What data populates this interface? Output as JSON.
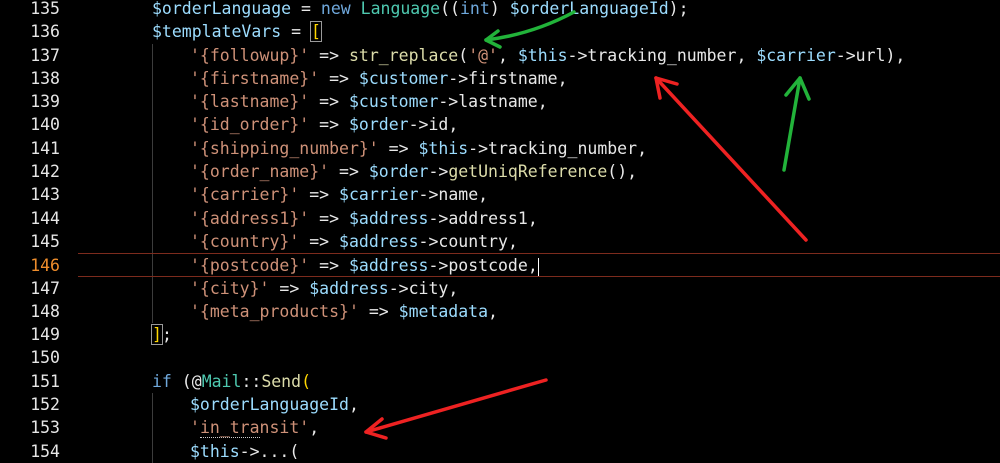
{
  "editor": {
    "lines": [
      {
        "num": "135",
        "tokens": [
          [
            "var",
            "$orderLanguage"
          ],
          [
            "op",
            " = "
          ],
          [
            "kw",
            "new"
          ],
          [
            "op",
            " "
          ],
          [
            "cls",
            "Language"
          ],
          [
            "op",
            "(("
          ],
          [
            "kw",
            "int"
          ],
          [
            "op",
            ") "
          ],
          [
            "var",
            "$orderLanguageId"
          ],
          [
            "op",
            ");"
          ]
        ]
      },
      {
        "num": "136",
        "tokens": [
          [
            "var",
            "$templateVars"
          ],
          [
            "op",
            " = "
          ],
          [
            "brkbox",
            "["
          ]
        ]
      },
      {
        "num": "137",
        "tokens": [
          [
            "str",
            "'{followup}'"
          ],
          [
            "op",
            " => "
          ],
          [
            "fn",
            "str_replace"
          ],
          [
            "op",
            "("
          ],
          [
            "str",
            "'@'"
          ],
          [
            "op",
            ", "
          ],
          [
            "var",
            "$this"
          ],
          [
            "op",
            "->"
          ],
          [
            "prop",
            "tracking_number"
          ],
          [
            "op",
            ", "
          ],
          [
            "var",
            "$carrier"
          ],
          [
            "op",
            "->"
          ],
          [
            "prop",
            "url"
          ],
          [
            "op",
            "),"
          ]
        ]
      },
      {
        "num": "138",
        "tokens": [
          [
            "str",
            "'{firstname}'"
          ],
          [
            "op",
            " => "
          ],
          [
            "var",
            "$customer"
          ],
          [
            "op",
            "->"
          ],
          [
            "prop",
            "firstname"
          ],
          [
            "op",
            ","
          ]
        ]
      },
      {
        "num": "139",
        "tokens": [
          [
            "str",
            "'{lastname}'"
          ],
          [
            "op",
            " => "
          ],
          [
            "var",
            "$customer"
          ],
          [
            "op",
            "->"
          ],
          [
            "prop",
            "lastname"
          ],
          [
            "op",
            ","
          ]
        ]
      },
      {
        "num": "140",
        "tokens": [
          [
            "str",
            "'{id_order}'"
          ],
          [
            "op",
            " => "
          ],
          [
            "var",
            "$order"
          ],
          [
            "op",
            "->"
          ],
          [
            "prop",
            "id"
          ],
          [
            "op",
            ","
          ]
        ]
      },
      {
        "num": "141",
        "tokens": [
          [
            "str",
            "'{shipping_number}'"
          ],
          [
            "op",
            " => "
          ],
          [
            "var",
            "$this"
          ],
          [
            "op",
            "->"
          ],
          [
            "prop",
            "tracking_number"
          ],
          [
            "op",
            ","
          ]
        ]
      },
      {
        "num": "142",
        "tokens": [
          [
            "str",
            "'{order_name}'"
          ],
          [
            "op",
            " => "
          ],
          [
            "var",
            "$order"
          ],
          [
            "op",
            "->"
          ],
          [
            "fn",
            "getUniqReference"
          ],
          [
            "op",
            "(),"
          ]
        ]
      },
      {
        "num": "143",
        "tokens": [
          [
            "str",
            "'{carrier}'"
          ],
          [
            "op",
            " => "
          ],
          [
            "var",
            "$carrier"
          ],
          [
            "op",
            "->"
          ],
          [
            "prop",
            "name"
          ],
          [
            "op",
            ","
          ]
        ]
      },
      {
        "num": "144",
        "tokens": [
          [
            "str",
            "'{address1}'"
          ],
          [
            "op",
            " => "
          ],
          [
            "var",
            "$address"
          ],
          [
            "op",
            "->"
          ],
          [
            "prop",
            "address1"
          ],
          [
            "op",
            ","
          ]
        ]
      },
      {
        "num": "145",
        "tokens": [
          [
            "str",
            "'{country}'"
          ],
          [
            "op",
            " => "
          ],
          [
            "var",
            "$address"
          ],
          [
            "op",
            "->"
          ],
          [
            "prop",
            "country"
          ],
          [
            "op",
            ","
          ]
        ]
      },
      {
        "num": "146",
        "tokens": [
          [
            "str",
            "'{postcode}'"
          ],
          [
            "op",
            " => "
          ],
          [
            "var",
            "$address"
          ],
          [
            "op",
            "->"
          ],
          [
            "prop",
            "postcode"
          ],
          [
            "op",
            ","
          ],
          [
            "cursor",
            ""
          ]
        ]
      },
      {
        "num": "147",
        "tokens": [
          [
            "str",
            "'{city}'"
          ],
          [
            "op",
            " => "
          ],
          [
            "var",
            "$address"
          ],
          [
            "op",
            "->"
          ],
          [
            "prop",
            "city"
          ],
          [
            "op",
            ","
          ]
        ]
      },
      {
        "num": "148",
        "tokens": [
          [
            "str",
            "'{meta_products}'"
          ],
          [
            "op",
            " => "
          ],
          [
            "var",
            "$metadata"
          ],
          [
            "op",
            ","
          ]
        ]
      },
      {
        "num": "149",
        "tokens": [
          [
            "brkbox",
            "]"
          ],
          [
            "op",
            ";"
          ]
        ]
      },
      {
        "num": "150",
        "tokens": []
      },
      {
        "num": "151",
        "tokens": [
          [
            "kw",
            "if"
          ],
          [
            "op",
            " ("
          ],
          [
            "op",
            "@"
          ],
          [
            "cls",
            "Mail"
          ],
          [
            "op",
            "::"
          ],
          [
            "fn",
            "Send"
          ],
          [
            "brk",
            "("
          ]
        ]
      },
      {
        "num": "152",
        "tokens": [
          [
            "var",
            "$orderLanguageId"
          ],
          [
            "op",
            ","
          ]
        ]
      },
      {
        "num": "153",
        "tokens": [
          [
            "str",
            "'"
          ],
          [
            "dotted",
            "in_tra"
          ],
          [
            "str",
            "nsit'"
          ],
          [
            "op",
            ","
          ]
        ]
      },
      {
        "num": "154",
        "tokens": [
          [
            "var",
            "$this"
          ],
          [
            "op",
            "->"
          ],
          [
            "prop",
            "..."
          ],
          [
            "op",
            "("
          ]
        ]
      }
    ],
    "current_line": "146"
  },
  "colors": {
    "background": "#000000",
    "current_line_border": "#7d2b1d",
    "current_line_number": "#ee8d2c",
    "arrow_green": "#22b33a",
    "arrow_red": "#ee2222"
  }
}
